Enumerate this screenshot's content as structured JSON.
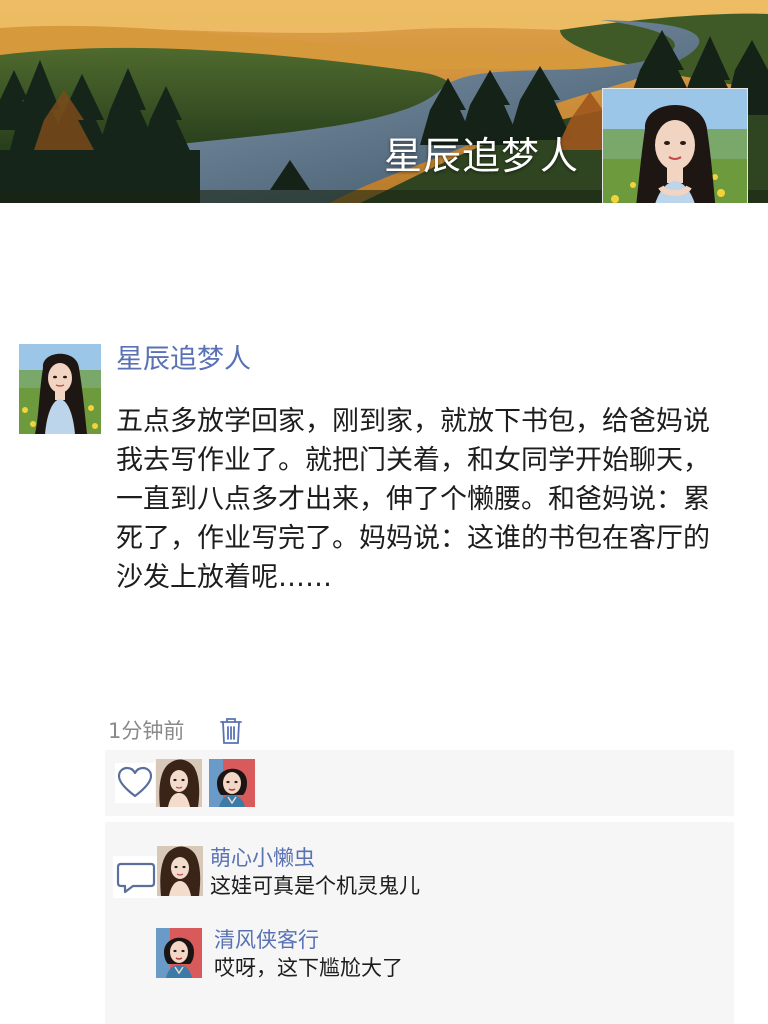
{
  "profile": {
    "nickname": "星辰追梦人"
  },
  "post": {
    "author": "星辰追梦人",
    "text": "五点多放学回家，刚到家，就放下书包，给爸妈说我去写作业了。就把门关着，和女同学开始聊天，一直到八点多才出来，伸了个懒腰。和爸妈说：累死了，作业写完了。妈妈说：这谁的书包在客厅的沙发上放着呢……",
    "time": "1分钟前"
  },
  "likes": {
    "icon": "heart-icon",
    "avatars": [
      "avatar-girl-curly-hair",
      "avatar-girl-red-background"
    ]
  },
  "comments": [
    {
      "user": "萌心小懒虫",
      "text": "这娃可真是个机灵鬼儿"
    },
    {
      "user": "清风侠客行",
      "text": "哎呀，这下尴尬大了"
    }
  ],
  "colors": {
    "link": "#5a72b4",
    "panel": "#f6f6f6"
  }
}
